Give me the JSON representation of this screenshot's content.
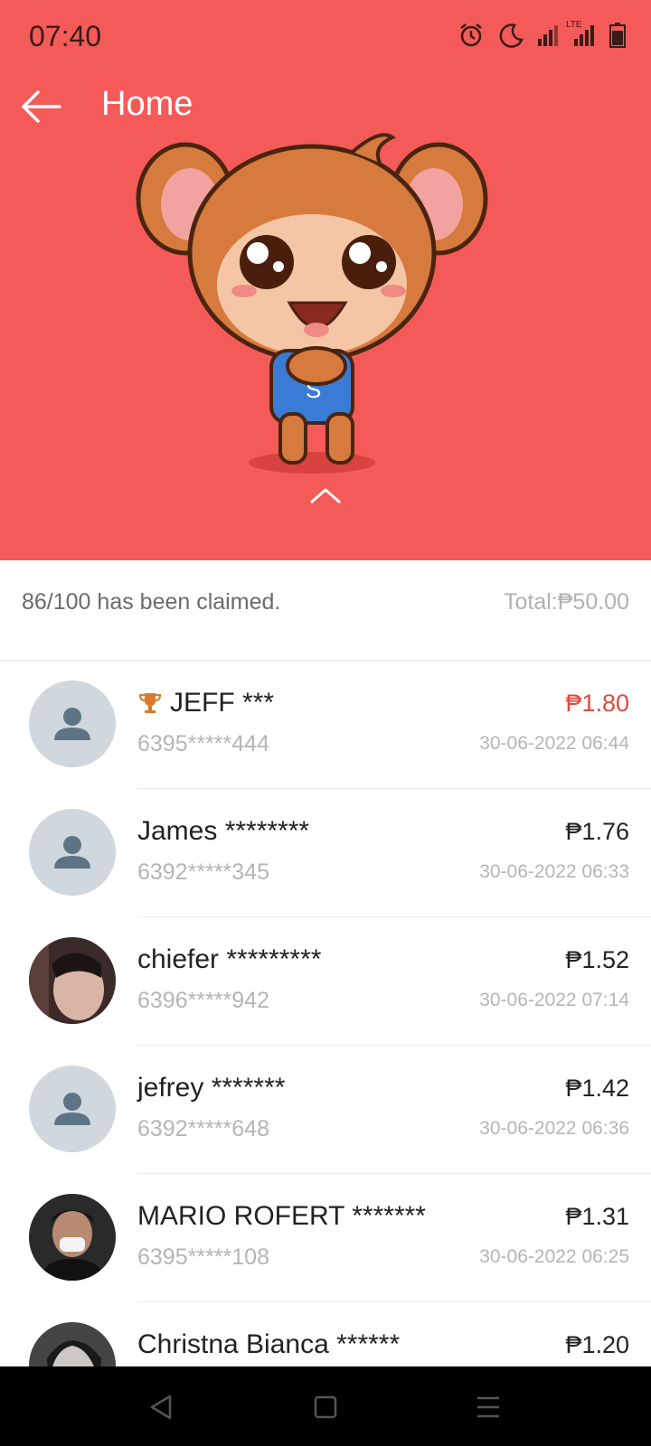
{
  "status_bar": {
    "time": "07:40",
    "icons": [
      "alarm-icon",
      "do-not-disturb-moon-icon",
      "signal-icon",
      "lte-signal-icon",
      "battery-icon"
    ],
    "network_label": "LTE"
  },
  "topbar": {
    "title": "Home",
    "back_icon": "arrow-left-icon"
  },
  "colors": {
    "header_bg": "#f45b58",
    "top_amount": "#e04a3f",
    "trophy": "#d87a2e"
  },
  "mascot_letter": "S",
  "summary": {
    "claimed": "86/100 has been claimed.",
    "total": "Total:₱50.00"
  },
  "claims": [
    {
      "name": "JEFF ***",
      "phone": "6395*****444",
      "amount": "₱1.80",
      "date": "30-06-2022 06:44",
      "top": true,
      "avatar": "default"
    },
    {
      "name": "James ********",
      "phone": "6392*****345",
      "amount": "₱1.76",
      "date": "30-06-2022 06:33",
      "top": false,
      "avatar": "default"
    },
    {
      "name": "chiefer *********",
      "phone": "6396*****942",
      "amount": "₱1.52",
      "date": "30-06-2022 07:14",
      "top": false,
      "avatar": "photo"
    },
    {
      "name": "jefrey *******",
      "phone": "6392*****648",
      "amount": "₱1.42",
      "date": "30-06-2022 06:36",
      "top": false,
      "avatar": "default"
    },
    {
      "name": "MARIO ROFERT *******",
      "phone": "6395*****108",
      "amount": "₱1.31",
      "date": "30-06-2022 06:25",
      "top": false,
      "avatar": "photo"
    },
    {
      "name": "Christna Bianca ******",
      "phone": "",
      "amount": "₱1.20",
      "date": "",
      "top": false,
      "avatar": "photo"
    }
  ],
  "nav": {
    "back_icon": "triangle-back-icon",
    "home_icon": "square-home-icon",
    "menu_icon": "menu-lines-icon"
  }
}
